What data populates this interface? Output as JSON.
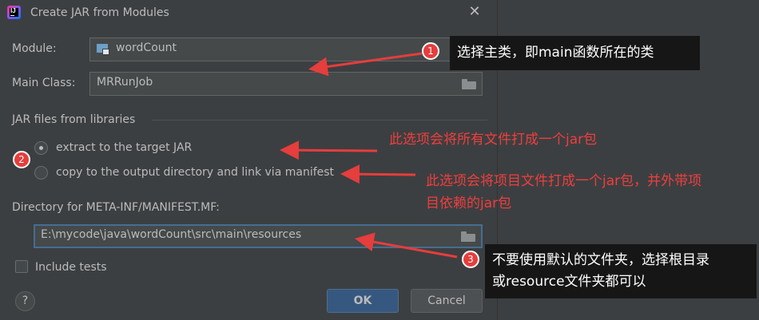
{
  "window": {
    "title": "Create JAR from Modules"
  },
  "form": {
    "module_label": "Module:",
    "module_value": "wordCount",
    "main_class_label": "Main Class:",
    "main_class_value": "MRRunJob",
    "jar_files_section": "JAR files from libraries",
    "option_extract": "extract to the target JAR",
    "option_copy": "copy to the output directory and link via manifest",
    "option_selected": "extract to the target JAR",
    "manifest_dir_label": "Directory for META-INF/MANIFEST.MF:",
    "manifest_dir_value": "E:\\mycode\\java\\wordCount\\src\\main\\resources",
    "include_tests_label": "Include tests",
    "include_tests_checked": false
  },
  "buttons": {
    "help": "?",
    "ok": "OK",
    "cancel": "Cancel"
  },
  "annotations": {
    "badge1": "1",
    "badge2": "2",
    "badge3": "3",
    "note1": "选择主类，即main函数所在的类",
    "note2": "此选项会将所有文件打成一个jar包",
    "note3_line1": "此选项会将项目文件打成一个jar包，并外带项",
    "note3_line2": "目依赖的jar包",
    "note4_line1": "不要使用默认的文件夹，选择根目录",
    "note4_line2": "或resource文件夹都可以"
  },
  "colors": {
    "background": "#3c3f41",
    "field_bg": "#45494a",
    "ok_button": "#365880",
    "annotation_red": "#ef3e3e",
    "note_dark": "#161616"
  },
  "icons": {
    "app": "intellij-idea-icon",
    "close": "close-icon",
    "module": "module-icon",
    "browse": "folder-icon",
    "help": "help-icon"
  }
}
